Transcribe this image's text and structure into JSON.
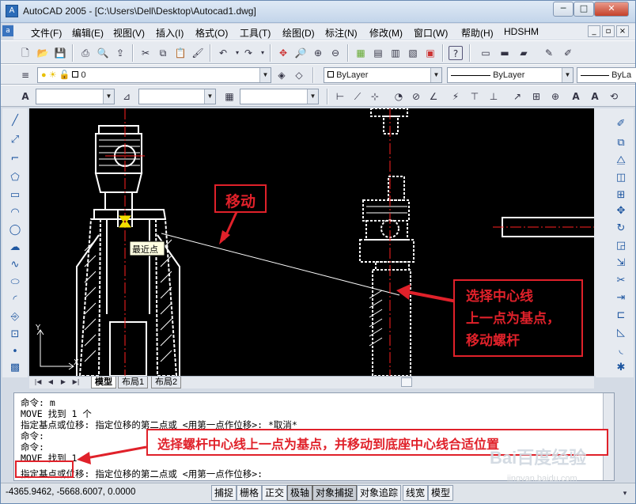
{
  "window": {
    "title": "AutoCAD 2005 - [C:\\Users\\Dell\\Desktop\\Autocad1.dwg]",
    "app_icon_label": "A",
    "min_label": "─",
    "max_label": "□",
    "close_label": "✕"
  },
  "menu": {
    "items": [
      "文件(F)",
      "编辑(E)",
      "视图(V)",
      "插入(I)",
      "格式(O)",
      "工具(T)",
      "绘图(D)",
      "标注(N)",
      "修改(M)",
      "窗口(W)",
      "帮助(H)",
      "HDSHM"
    ],
    "mdi_min": "_",
    "mdi_restore": "▫",
    "mdi_close": "×"
  },
  "layers": {
    "current_layer": "0",
    "color": "ByLayer",
    "linetype": "ByLayer",
    "lineweight": "ByLa"
  },
  "drawing": {
    "snap_tooltip": "最近点",
    "ucs_y": "Y",
    "ucs_x": "X"
  },
  "tabs": [
    "模型",
    "布局1",
    "布局2"
  ],
  "command_history": [
    "命令: m",
    "MOVE 找到 1 个",
    "指定基点或位移: 指定位移的第二点或 <用第一点作位移>: *取消*",
    "命令:",
    "命令:",
    "MOVE 找到 1 个",
    "指定基点或位移: 指定位移的第二点或 <用第一点作位移>:"
  ],
  "status": {
    "coords": "-4365.9462, -5668.6007, 0.0000",
    "buttons": [
      {
        "label": "捕捉",
        "on": false
      },
      {
        "label": "栅格",
        "on": false
      },
      {
        "label": "正交",
        "on": false
      },
      {
        "label": "极轴",
        "on": true
      },
      {
        "label": "对象捕捉",
        "on": true
      },
      {
        "label": "对象追踪",
        "on": false
      },
      {
        "label": "线宽",
        "on": false
      },
      {
        "label": "模型",
        "on": false
      }
    ]
  },
  "annotations": {
    "move_label": "移动",
    "base_point_lines": [
      "选择中心线",
      "上一点为基点，",
      "移动螺杆"
    ],
    "bottom_note": "选择螺杆中心线上一点为基点，并移动到底座中心线合适位置"
  },
  "watermark": {
    "brand": "Bai百度经验",
    "url": "jingyan.baidu.com"
  },
  "colors": {
    "annotation_red": "#e0212a",
    "canvas": "#000000",
    "center_line": "#ff2020"
  }
}
